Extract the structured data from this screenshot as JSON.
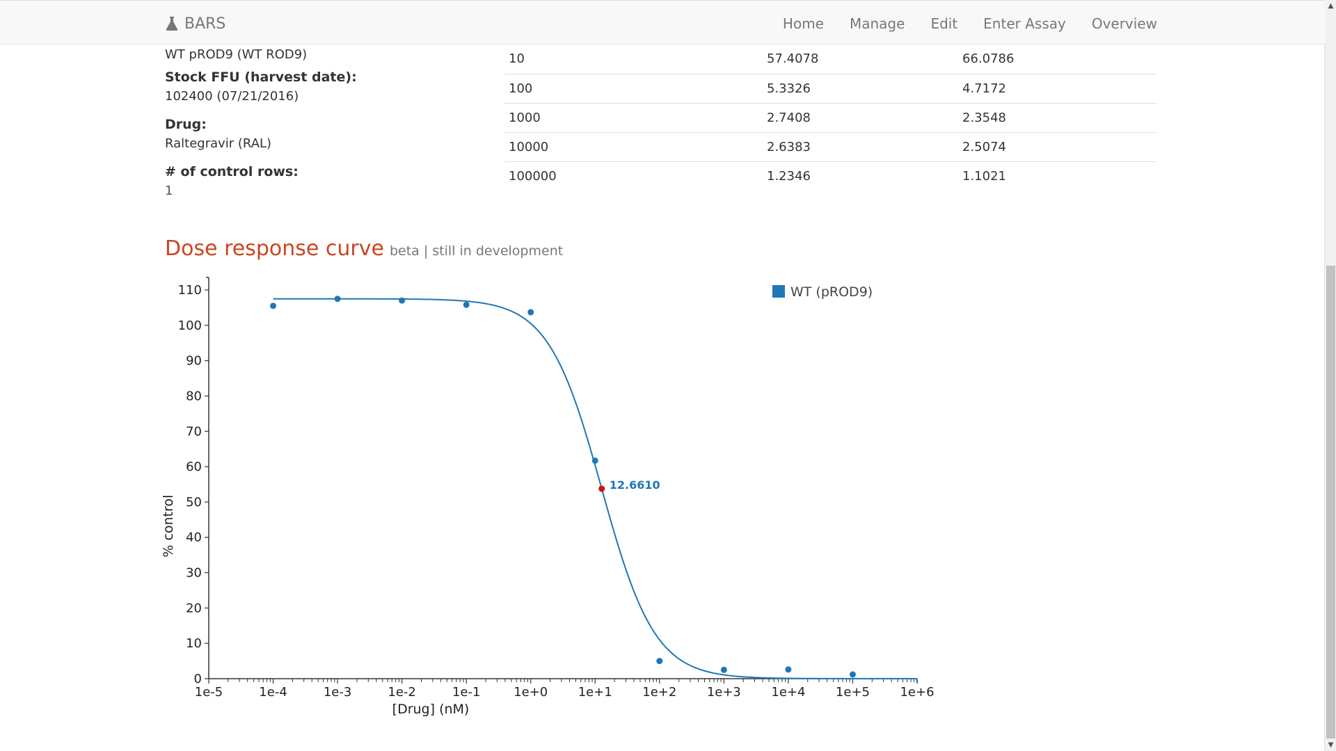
{
  "navbar": {
    "brand": "BARS",
    "links": [
      "Home",
      "Manage",
      "Edit",
      "Enter Assay",
      "Overview"
    ]
  },
  "info": {
    "virus_value": "WT pROD9 (WT ROD9)",
    "stock_label": "Stock FFU (harvest date):",
    "stock_value": "102400 (07/21/2016)",
    "drug_label": "Drug:",
    "drug_value": "Raltegravir (RAL)",
    "control_label": "# of control rows:",
    "control_value": "1"
  },
  "table": {
    "rows": [
      [
        "10",
        "57.4078",
        "66.0786"
      ],
      [
        "100",
        "5.3326",
        "4.7172"
      ],
      [
        "1000",
        "2.7408",
        "2.3548"
      ],
      [
        "10000",
        "2.6383",
        "2.5074"
      ],
      [
        "100000",
        "1.2346",
        "1.1021"
      ]
    ]
  },
  "section": {
    "title": "Dose response curve",
    "subtitle": "beta | still in development"
  },
  "chart_data": {
    "type": "scatter",
    "xscale": "log",
    "xlim": [
      1e-05,
      1000000
    ],
    "ylim": [
      0,
      110
    ],
    "xlabel": "[Drug] (nM)",
    "ylabel": "% control",
    "x_ticks": [
      "1e-5",
      "1e-4",
      "1e-3",
      "1e-2",
      "1e-1",
      "1e+0",
      "1e+1",
      "1e+2",
      "1e+3",
      "1e+4",
      "1e+5",
      "1e+6"
    ],
    "y_ticks": [
      0,
      10,
      20,
      30,
      40,
      50,
      60,
      70,
      80,
      90,
      100,
      110
    ],
    "legend": {
      "position": "top-right",
      "label": "WT (pROD9)"
    },
    "series": [
      {
        "name": "WT (pROD9)",
        "color": "#1f77b4",
        "points": [
          [
            0.0001,
            105.5
          ],
          [
            0.001,
            107.5
          ],
          [
            0.01,
            107.0
          ],
          [
            0.1,
            105.8
          ],
          [
            1,
            103.7
          ],
          [
            10,
            61.7
          ],
          [
            100,
            5.0
          ],
          [
            1000,
            2.5
          ],
          [
            10000,
            2.6
          ],
          [
            100000,
            1.2
          ]
        ],
        "fit": {
          "top": 107.5,
          "bottom": 0,
          "ic50": 12.661,
          "hill": 1.05
        }
      }
    ],
    "ic50_marker": {
      "x": 12.661,
      "y": 53.75,
      "label": "12.6610",
      "color": "#cc1111"
    }
  }
}
